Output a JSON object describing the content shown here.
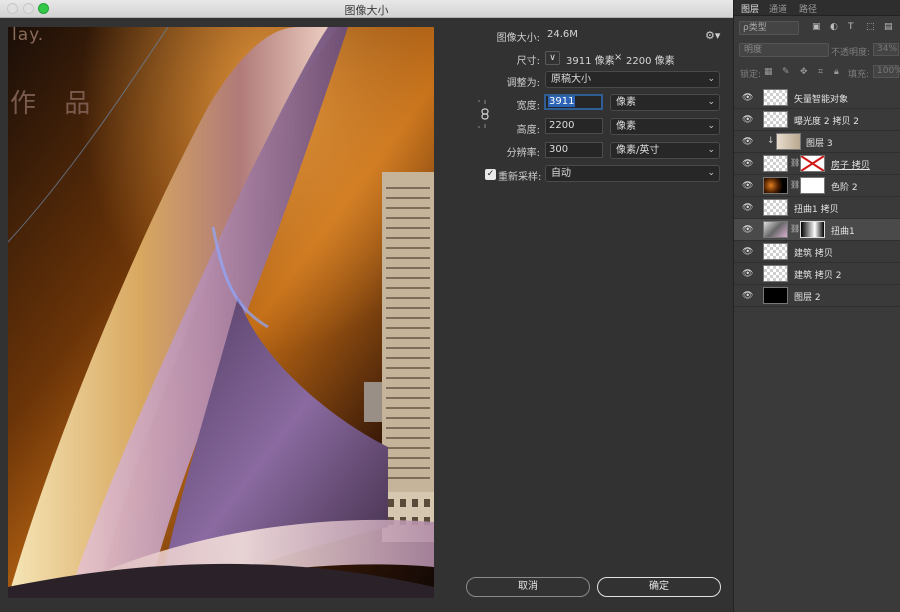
{
  "window": {
    "title": "图像大小"
  },
  "preview": {
    "text_line1": "lay.",
    "text_line2": "作 品"
  },
  "form": {
    "image_size_label": "图像大小:",
    "image_size_value": "24.6M",
    "dimensions_label": "尺寸:",
    "dim_width": "3911 像素",
    "dim_times": "×",
    "dim_height": "2200 像素",
    "fit_to_label": "调整为:",
    "fit_to_value": "原稿大小",
    "width_label": "宽度:",
    "width_value": "3911",
    "width_unit": "像素",
    "height_label": "高度:",
    "height_value": "2200",
    "height_unit": "像素",
    "resolution_label": "分辨率:",
    "resolution_value": "300",
    "resolution_unit": "像素/英寸",
    "resample_label": "重新采样:",
    "resample_checked": true,
    "resample_value": "自动",
    "cancel_label": "取消",
    "ok_label": "确定"
  },
  "icons": {
    "gear": "gear-icon",
    "link": "link-icon",
    "eye": "eye-icon",
    "chevron": "chevron-down-icon"
  },
  "panel": {
    "tabs": [
      "图层",
      "通道",
      "路径"
    ],
    "kind_filter": "ρ类型",
    "blend_mode": "明度",
    "opacity_label": "不透明度:",
    "opacity_value": "34%",
    "lock_label": "锁定:",
    "fill_label": "填充:",
    "fill_value": "100%",
    "layers": [
      {
        "name": "矢量智能对象"
      },
      {
        "name": "曝光度 2 拷贝 2"
      },
      {
        "name": "图层 3"
      },
      {
        "name": "房子 拷贝"
      },
      {
        "name": "色阶 2"
      },
      {
        "name": "扭曲1 拷贝"
      },
      {
        "name": "扭曲1"
      },
      {
        "name": "建筑 拷贝"
      },
      {
        "name": "建筑 拷贝 2"
      },
      {
        "name": "图层 2"
      }
    ]
  },
  "colors": {
    "dialog_bg": "#323232",
    "panel_bg": "#3a3a3a",
    "accent_blue": "#2d63b5",
    "zoom_green": "#33c748"
  }
}
